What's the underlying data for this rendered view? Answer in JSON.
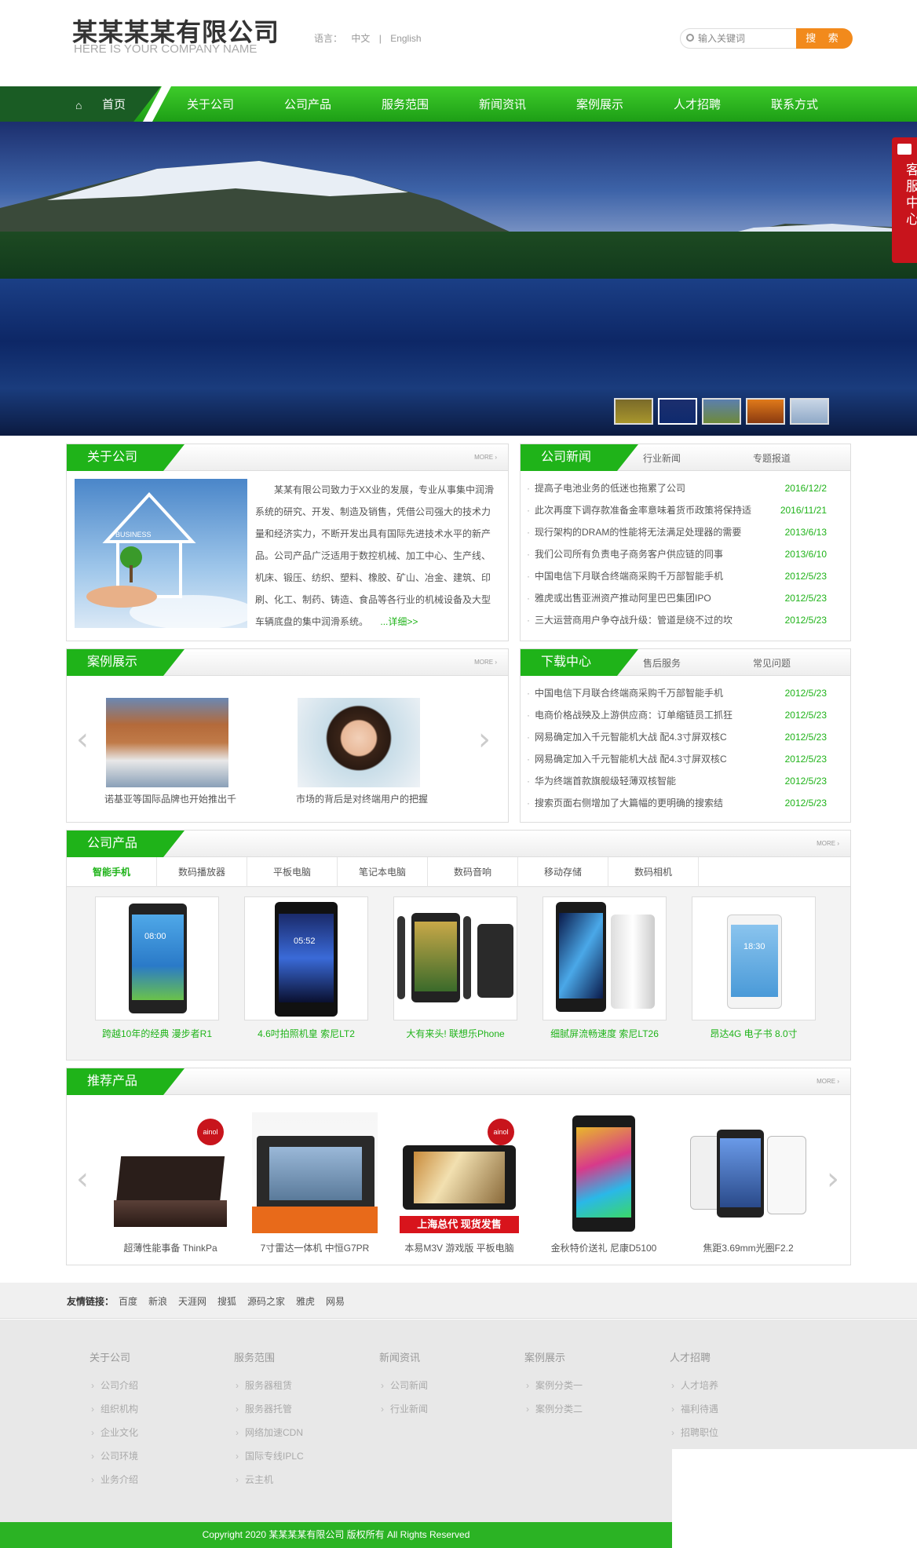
{
  "header": {
    "logo_cn": "某某某某有限公司",
    "logo_en": "HERE IS YOUR COMPANY NAME",
    "lang_label": "语言：",
    "lang_cn": "中文",
    "lang_sep": "|",
    "lang_en": "English",
    "search_placeholder": "输入关键词",
    "search_button": "搜 索"
  },
  "nav": {
    "home": "首页",
    "items": [
      "关于公司",
      "公司产品",
      "服务范围",
      "新闻资讯",
      "案例展示",
      "人才招聘",
      "联系方式"
    ]
  },
  "kefu": "客服中心",
  "about": {
    "title": "关于公司",
    "more": "MORE ›",
    "text": "某某有限公司致力于XX业的发展，专业从事集中润滑系统的研究、开发、制造及销售，凭借公司强大的技术力量和经济实力，不断开发出具有国际先进技术水平的新产品。公司产品广泛适用于数控机械、加工中心、生产线、机床、锻压、纺织、塑料、橡胶、矿山、冶金、建筑、印刷、化工、制药、铸造、食品等各行业的机械设备及大型车辆底盘的集中润滑系统。",
    "detail": "...详细>>",
    "image_label": "BUSINESS"
  },
  "news": {
    "title": "公司新闻",
    "tab1": "行业新闻",
    "tab2": "专题报道",
    "items": [
      {
        "t": "提高子电池业务的低迷也拖累了公司",
        "d": "2016/12/2"
      },
      {
        "t": "此次再度下调存款准备金率意味着货币政策将保持适",
        "d": "2016/11/21"
      },
      {
        "t": "现行架构的DRAM的性能将无法满足处理器的需要",
        "d": "2013/6/13"
      },
      {
        "t": "我们公司所有负责电子商务客户供应链的同事",
        "d": "2013/6/10"
      },
      {
        "t": "中国电信下月联合终端商采购千万部智能手机",
        "d": "2012/5/23"
      },
      {
        "t": "雅虎或出售亚洲资产推动阿里巴巴集团IPO",
        "d": "2012/5/23"
      },
      {
        "t": "三大运营商用户争夺战升级：管道是绕不过的坎",
        "d": "2012/5/23"
      }
    ]
  },
  "cases": {
    "title": "案例展示",
    "more": "MORE ›",
    "prev": "‹",
    "next": "›",
    "items": [
      {
        "cap": "诺基亚等国际品牌也开始推出千"
      },
      {
        "cap": "市场的背后是对终端用户的把握"
      }
    ]
  },
  "download": {
    "title": "下载中心",
    "tab1": "售后服务",
    "tab2": "常见问题",
    "items": [
      {
        "t": "中国电信下月联合终端商采购千万部智能手机",
        "d": "2012/5/23"
      },
      {
        "t": "电商价格战殃及上游供应商：订单缩链员工抓狂",
        "d": "2012/5/23"
      },
      {
        "t": "网易确定加入千元智能机大战 配4.3寸屏双核C",
        "d": "2012/5/23"
      },
      {
        "t": "网易确定加入千元智能机大战 配4.3寸屏双核C",
        "d": "2012/5/23"
      },
      {
        "t": "华为终端首款旗舰级轻薄双核智能",
        "d": "2012/5/23"
      },
      {
        "t": "搜索页面右侧增加了大篇幅的更明确的搜索结",
        "d": "2012/5/23"
      }
    ]
  },
  "products": {
    "title": "公司产品",
    "more": "MORE ›",
    "tabs": [
      "智能手机",
      "数码播放器",
      "平板电脑",
      "笔记本电脑",
      "数码音响",
      "移动存储",
      "数码相机"
    ],
    "items": [
      {
        "cap": "跨越10年的经典 漫步者R1",
        "screen": "08:00"
      },
      {
        "cap": "4.6吋拍照机皇 索尼LT2",
        "screen": "05:52"
      },
      {
        "cap": "大有来头! 联想乐Phone",
        "screen": ""
      },
      {
        "cap": "细腻屏流畅速度 索尼LT26",
        "screen": ""
      },
      {
        "cap": "昂达4G 电子书 8.0寸",
        "screen": "18:30"
      }
    ]
  },
  "recommend": {
    "title": "推荐产品",
    "more": "MORE ›",
    "prev": "‹",
    "next": "›",
    "badge": "ainol",
    "banner_text": "上海总代 现货发售",
    "items": [
      {
        "cap": "超薄性能事备 ThinkPa"
      },
      {
        "cap": "7寸雷达一体机 中恒G7PR"
      },
      {
        "cap": "本易M3V 游戏版 平板电脑"
      },
      {
        "cap": "金秋特价送礼 尼康D5100"
      },
      {
        "cap": "焦距3.69mm光圈F2.2"
      }
    ]
  },
  "friend_links": {
    "label": "友情链接：",
    "items": [
      "百度",
      "新浪",
      "天涯网",
      "搜狐",
      "源码之家",
      "雅虎",
      "网易"
    ]
  },
  "footer": {
    "columns": [
      {
        "title": "关于公司",
        "items": [
          "公司介绍",
          "组织机构",
          "企业文化",
          "公司环境",
          "业务介绍"
        ]
      },
      {
        "title": "服务范围",
        "items": [
          "服务器租赁",
          "服务器托管",
          "网络加速CDN",
          "国际专线IPLC",
          "云主机"
        ]
      },
      {
        "title": "新闻资讯",
        "items": [
          "公司新闻",
          "行业新闻"
        ]
      },
      {
        "title": "案例展示",
        "items": [
          "案例分类一",
          "案例分类二"
        ]
      },
      {
        "title": "人才招聘",
        "items": [
          "人才培养",
          "福利待遇",
          "招聘职位"
        ]
      }
    ],
    "copyright": "Copyright 2020 某某某某有限公司 版权所有 All Rights Reserved"
  },
  "colors": {
    "brand_green": "#1fb319",
    "nav_dark": "#1a5c24",
    "search_orange": "#f28a1c",
    "kefu_red": "#c8141c"
  }
}
